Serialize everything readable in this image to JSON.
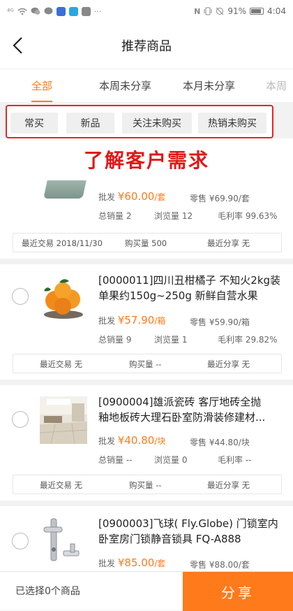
{
  "status_bar": {
    "signal": "⁴ᴳ",
    "battery_percent": "91%",
    "time": "4:04",
    "more": "···"
  },
  "header": {
    "title": "推荐商品"
  },
  "tabs": [
    {
      "label": "全部",
      "active": true
    },
    {
      "label": "本周未分享",
      "active": false
    },
    {
      "label": "本月未分享",
      "active": false
    },
    {
      "label": "本周",
      "active": false
    }
  ],
  "filters": [
    {
      "label": "常买"
    },
    {
      "label": "新品"
    },
    {
      "label": "关注未购买"
    },
    {
      "label": "热销未购买"
    }
  ],
  "banner": {
    "text": "了解客户需求"
  },
  "products": [
    {
      "wholesale_label": "批发",
      "wholesale_price": "¥60.00",
      "wholesale_unit": "/套",
      "retail": "零售 ¥69.90/套",
      "total_sales": "总销量 2",
      "views": "浏览量 12",
      "margin": "毛利率 99.63%",
      "last_trade": "最近交易 2018/11/30",
      "purchase": "购买量 500",
      "last_share": "最近分享 无"
    },
    {
      "name": "[0000011]四川丑柑橘子 不知火2kg装 单果约150g~250g 新鲜自营水果",
      "wholesale_label": "批发",
      "wholesale_price": "¥57.90",
      "wholesale_unit": "/箱",
      "retail": "零售 ¥59.90/箱",
      "total_sales": "总销量 9",
      "views": "浏览量 1",
      "margin": "毛利率 29.82%",
      "last_trade": "最近交易 无",
      "purchase": "购买量 --",
      "last_share": "最近分享 无"
    },
    {
      "name_line1": "[0900004]雄派瓷砖 客厅地砖全抛",
      "name_line2": "釉地板砖大理石卧室防滑装修建材...",
      "wholesale_label": "批发",
      "wholesale_price": "¥40.80",
      "wholesale_unit": "/块",
      "retail": "零售 ¥44.80/块",
      "total_sales": "总销量 --",
      "views": "浏览量 0",
      "margin": "毛利率 --",
      "last_trade": "最近交易 无",
      "purchase": "购买量 --",
      "last_share": "最近分享 无"
    },
    {
      "name": "[0900003]飞球( Fly.Globe) 门锁室内卧室房门锁静音锁具 FQ-A888",
      "wholesale_label": "批发",
      "wholesale_price": "¥85.00",
      "wholesale_unit": "/套",
      "retail": "零售 ¥88.00/套"
    }
  ],
  "bottom_bar": {
    "selected_text": "已选择0个商品",
    "share_label": "分享"
  },
  "colors": {
    "accent": "#ff7a1a",
    "highlight_red": "#e01818"
  }
}
